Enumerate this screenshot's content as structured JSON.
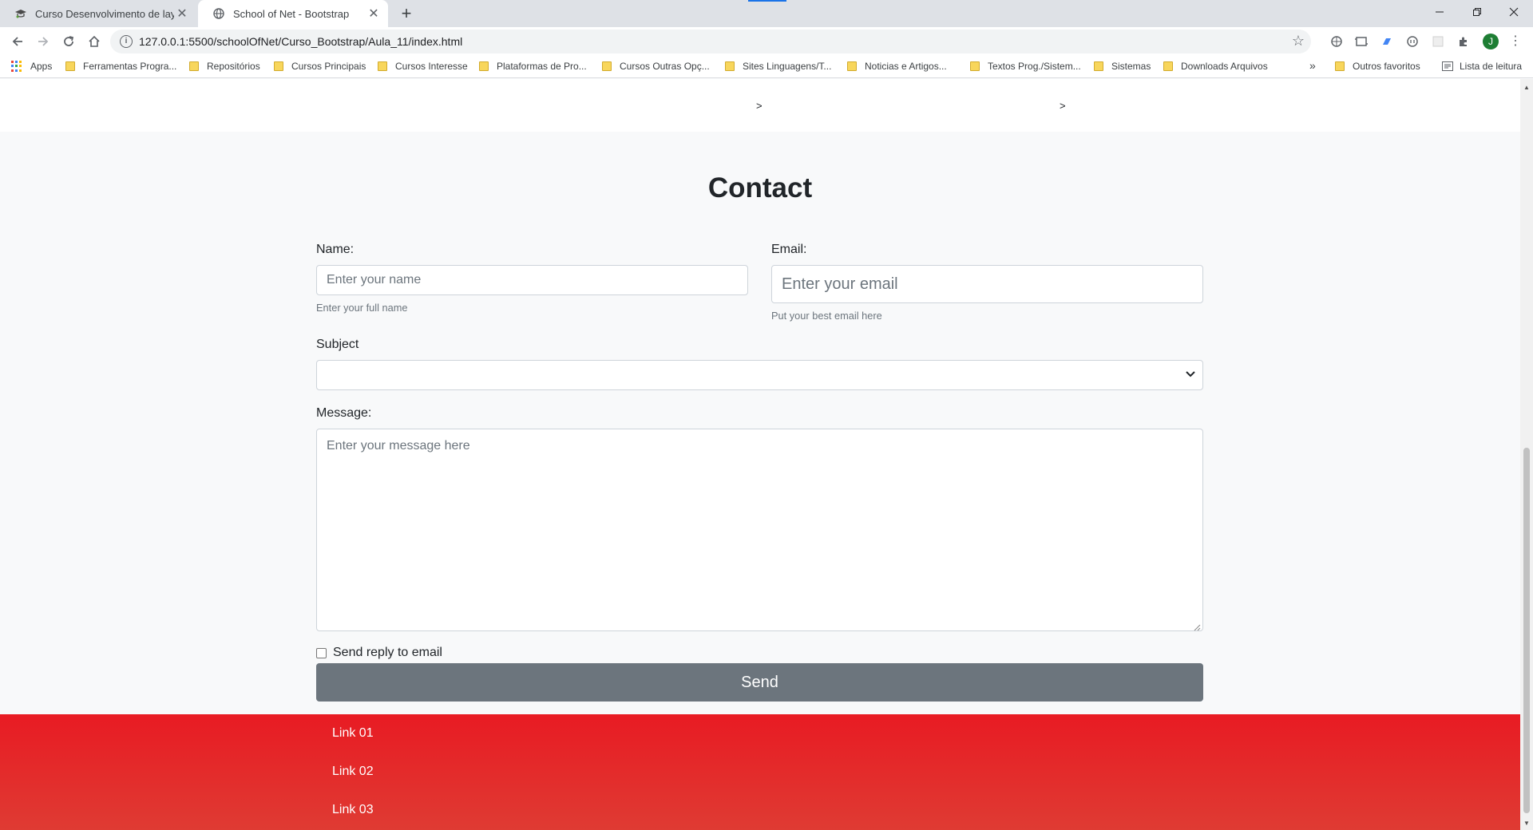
{
  "browser": {
    "tabs": [
      {
        "title": "Curso Desenvolvimento de layou",
        "favicon": "graduation-cap-icon",
        "active": false
      },
      {
        "title": "School of Net - Bootstrap",
        "favicon": "globe-icon",
        "active": true
      }
    ],
    "url": "127.0.0.1:5500/schoolOfNet/Curso_Bootstrap/Aula_11/index.html",
    "avatar_letter": "J",
    "bookmarks": [
      "Apps",
      "Ferramentas Progra...",
      "Repositórios",
      "Cursos Principais",
      "Cursos Interesse",
      "Plataformas de Pro...",
      "Cursos Outras Opç...",
      "Sites Linguagens/T...",
      "Noticias e Artigos...",
      "Textos Prog./Sistem...",
      "Sistemas",
      "Downloads Arquivos"
    ],
    "overflow_label": "»",
    "other_bookmarks": "Outros favoritos",
    "reading_list": "Lista de leitura"
  },
  "page": {
    "carousel_arrows": [
      ">",
      ">"
    ],
    "contact": {
      "title": "Contact",
      "name_label": "Name:",
      "name_placeholder": "Enter your name",
      "name_help": "Enter your full name",
      "email_label": "Email:",
      "email_placeholder": "Enter your email",
      "email_help": "Put your best email here",
      "subject_label": "Subject",
      "subject_value": "",
      "message_label": "Message:",
      "message_placeholder": "Enter your message here",
      "checkbox_label": "Send reply to email",
      "checkbox_checked": false,
      "send_label": "Send"
    },
    "footer_links": [
      "Link 01",
      "Link 02",
      "Link 03"
    ]
  },
  "colors": {
    "footer_top": "#e81b23",
    "footer_bottom": "#df3b33",
    "button_bg": "#6c757d",
    "page_bg": "#f8f9fa"
  }
}
